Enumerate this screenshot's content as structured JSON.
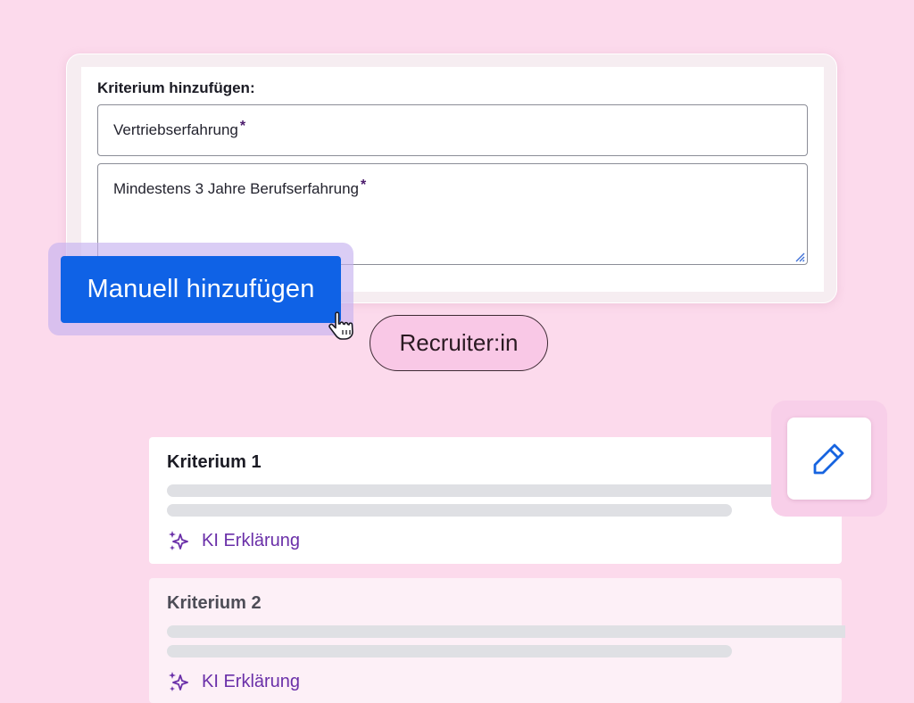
{
  "form": {
    "title": "Kriterium hinzufügen:",
    "criterion_name_value": "Vertriebserfahrung",
    "criterion_description_value": "Mindestens 3 Jahre Berufserfahrung",
    "required_marker": "*"
  },
  "actions": {
    "add_manual_label": "Manuell hinzufügen"
  },
  "role_badge": {
    "label": "Recruiter:in"
  },
  "criteria": [
    {
      "title": "Kriterium 1",
      "ai_link_label": "KI Erklärung"
    },
    {
      "title": "Kriterium 2",
      "ai_link_label": "KI Erklärung"
    }
  ],
  "icons": {
    "edit": "pencil-icon",
    "ai": "sparkle-icon",
    "cursor": "hand-pointer-icon"
  },
  "colors": {
    "background": "#fcdaec",
    "primary_button": "#0f62e6",
    "ai_link": "#6a2fa8",
    "pill_bg": "#f9c8e6"
  }
}
